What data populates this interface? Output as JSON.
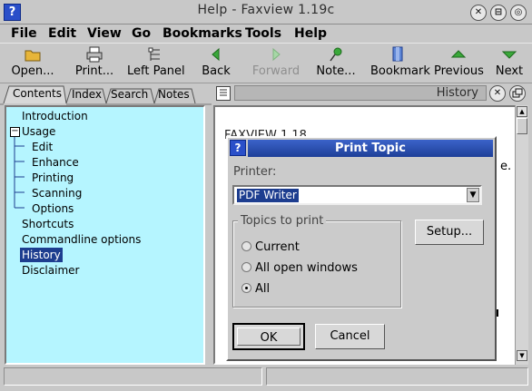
{
  "window": {
    "title": "Help - Faxview 1.19c",
    "help_badge": "?",
    "buttons": [
      "✕",
      "⊟",
      "◎"
    ]
  },
  "menu": [
    "File",
    "Edit",
    "View",
    "Go",
    "Bookmarks",
    "Tools",
    "Help"
  ],
  "toolbar": [
    {
      "label": "Open...",
      "icon": "folder-icon"
    },
    {
      "label": "Print...",
      "icon": "printer-icon"
    },
    {
      "label": "Left Panel",
      "icon": "left-panel-icon"
    },
    {
      "label": "Back",
      "icon": "back-arrow-icon"
    },
    {
      "label": "Forward",
      "icon": "forward-arrow-icon",
      "disabled": true
    },
    {
      "label": "Note...",
      "icon": "pin-icon"
    },
    {
      "label": "Bookmark",
      "icon": "bookmark-icon"
    },
    {
      "label": "Previous",
      "icon": "up-arrow-icon"
    },
    {
      "label": "Next",
      "icon": "down-arrow-icon"
    }
  ],
  "tabs": [
    "Contents",
    "Index",
    "Search",
    "Notes"
  ],
  "tree": {
    "introduction": "Introduction",
    "usage": "Usage",
    "usage_expander": "−",
    "usage_children": [
      "Edit",
      "Enhance",
      "Printing",
      "Scanning",
      "Options"
    ],
    "shortcuts": "Shortcuts",
    "commandline": "Commandline options",
    "history": "History",
    "disclaimer": "Disclaimer"
  },
  "right_panel": {
    "title": "History",
    "doc_partial_heading": "FAXVIEW 1.18",
    "doc_partial_char": "e."
  },
  "dialog": {
    "help_badge": "?",
    "title": "Print Topic",
    "printer_label": "Printer:",
    "printer_value": "PDF Writer",
    "combo_arrow": "▼",
    "topics_label": "Topics to print",
    "options": [
      "Current",
      "All open windows",
      "All"
    ],
    "selected_option": "All",
    "setup_label": "Setup...",
    "ok_label": "OK",
    "cancel_label": "Cancel"
  },
  "colors": {
    "tree_background": "#b5f5ff",
    "selection": "#1d3d8f",
    "dialog_title": "#2b4fb5"
  }
}
